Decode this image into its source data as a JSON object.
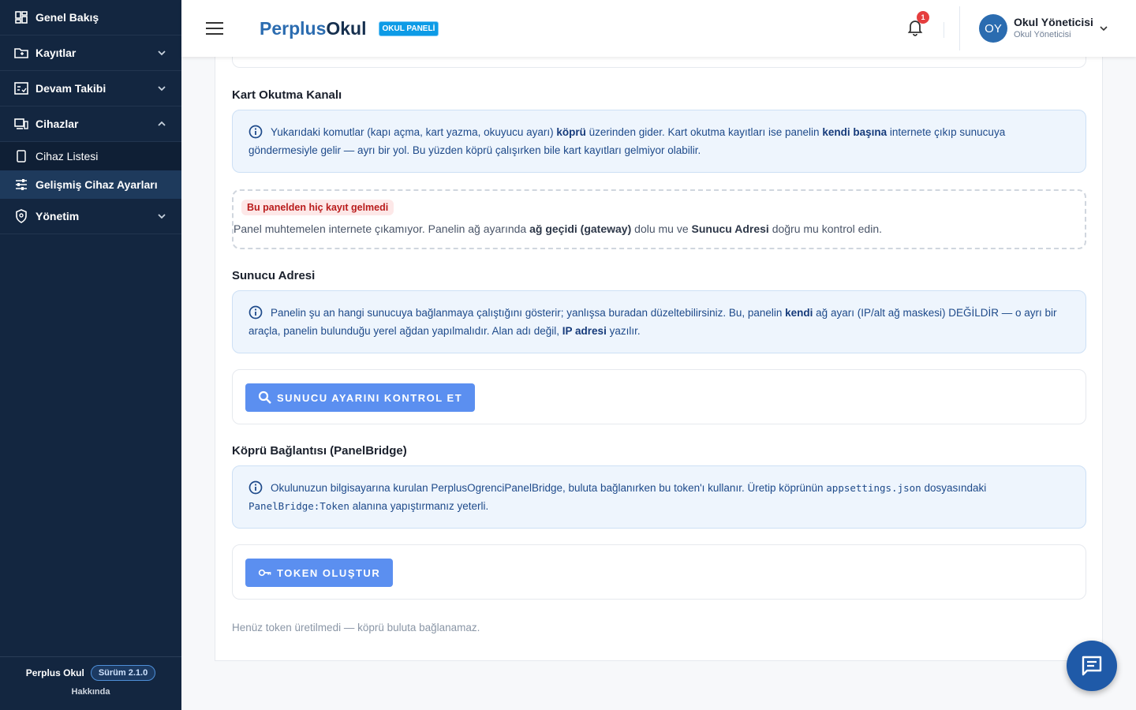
{
  "sidebar": {
    "items": [
      {
        "label": "Genel Bakış",
        "icon": "dashboard-icon"
      },
      {
        "label": "Kayıtlar",
        "icon": "folder-icon"
      },
      {
        "label": "Devam Takibi",
        "icon": "attendance-icon"
      },
      {
        "label": "Cihazlar",
        "icon": "devices-icon"
      },
      {
        "label": "Yönetim",
        "icon": "admin-icon"
      }
    ],
    "sub_items": [
      {
        "label": "Cihaz Listesi",
        "icon": "tablet-icon"
      },
      {
        "label": "Gelişmiş Cihaz Ayarları",
        "icon": "sliders-icon"
      }
    ],
    "footer": {
      "app_name": "Perplus Okul",
      "version": "Sürüm 2.1.0",
      "about": "Hakkında"
    }
  },
  "header": {
    "brand_part1": "Perplus",
    "brand_part2": "Okul",
    "badge": "OKUL PANELİ",
    "notification_count": "1",
    "avatar_initials": "OY",
    "user_name": "Okul Yöneticisi",
    "user_role": "Okul Yöneticisi"
  },
  "card_reading": {
    "title": "Kart Okutma Kanalı",
    "info_1": "Yukarıdaki komutlar (kapı açma, kart yazma, okuyucu ayarı) ",
    "info_b1": "köprü",
    "info_2": " üzerinden gider. Kart okutma kayıtları ise panelin ",
    "info_b2": "kendi başına",
    "info_3": " internete çıkıp sunucuya göndermesiyle gelir — ayrı bir yol. Bu yüzden köprü çalışırken bile kart kayıtları gelmiyor olabilir.",
    "warn_chip": "Bu panelden hiç kayıt gelmedi",
    "warn_1": "Panel muhtemelen internete çıkamıyor. Panelin ağ ayarında ",
    "warn_b1": "ağ geçidi (gateway)",
    "warn_2": " dolu mu ve ",
    "warn_b2": "Sunucu Adresi",
    "warn_3": " doğru mu kontrol edin."
  },
  "server": {
    "title": "Sunucu Adresi",
    "info_1": "Panelin şu an hangi sunucuya bağlanmaya çalıştığını gösterir; yanlışsa buradan düzeltebilirsiniz. Bu, panelin ",
    "info_b1": "kendi",
    "info_2": " ağ ayarı (IP/alt ağ maskesi) DEĞİLDİR — o ayrı bir araçla, panelin bulunduğu yerel ağdan yapılmalıdır. Alan adı değil, ",
    "info_b2": "IP adresi",
    "info_3": " yazılır.",
    "button": "SUNUCU AYARINI KONTROL ET"
  },
  "bridge": {
    "title": "Köprü Bağlantısı (PanelBridge)",
    "info_1": "Okulunuzun bilgisayarına kurulan PerplusOgrenciPanelBridge, buluta bağlanırken bu token'ı kullanır. Üretip köprünün ",
    "code_1": "appsettings.json",
    "info_2": " dosyasındaki ",
    "code_2": "PanelBridge:Token",
    "info_3": " alanına yapıştırmanız yeterli.",
    "button": "TOKEN OLUŞTUR",
    "note": "Henüz token üretilmedi — köprü buluta bağlanamaz."
  }
}
